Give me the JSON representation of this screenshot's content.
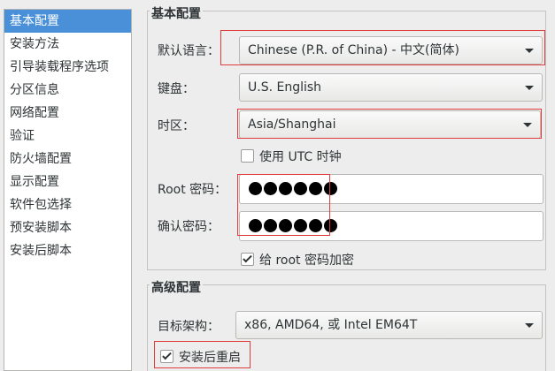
{
  "sidebar": {
    "items": [
      {
        "label": "基本配置",
        "selected": true
      },
      {
        "label": "安装方法"
      },
      {
        "label": "引导装载程序选项"
      },
      {
        "label": "分区信息"
      },
      {
        "label": "网络配置"
      },
      {
        "label": "验证"
      },
      {
        "label": "防火墙配置"
      },
      {
        "label": "显示配置"
      },
      {
        "label": "软件包选择"
      },
      {
        "label": "预安装脚本"
      },
      {
        "label": "安装后脚本"
      }
    ]
  },
  "basic": {
    "title": "基本配置",
    "language_label": "默认语言：",
    "language_value": "Chinese (P.R. of China) - 中文(简体)",
    "keyboard_label": "键盘：",
    "keyboard_value": "U.S. English",
    "timezone_label": "时区：",
    "timezone_value": "Asia/Shanghai",
    "utc_label": "使用  UTC 时钟",
    "utc_checked": false,
    "root_password_label": "Root 密码：",
    "confirm_password_label": "确认密码：",
    "encrypt_label": "给  root 密码加密",
    "encrypt_checked": true
  },
  "advanced": {
    "title": "高级配置",
    "arch_label": "目标架构：",
    "arch_value": "x86, AMD64, 或  Intel EM64T",
    "reboot_label": "安装后重启",
    "reboot_checked": true
  },
  "colors": {
    "selection": "#4a90d9",
    "highlight_box": "#e03c3c"
  }
}
